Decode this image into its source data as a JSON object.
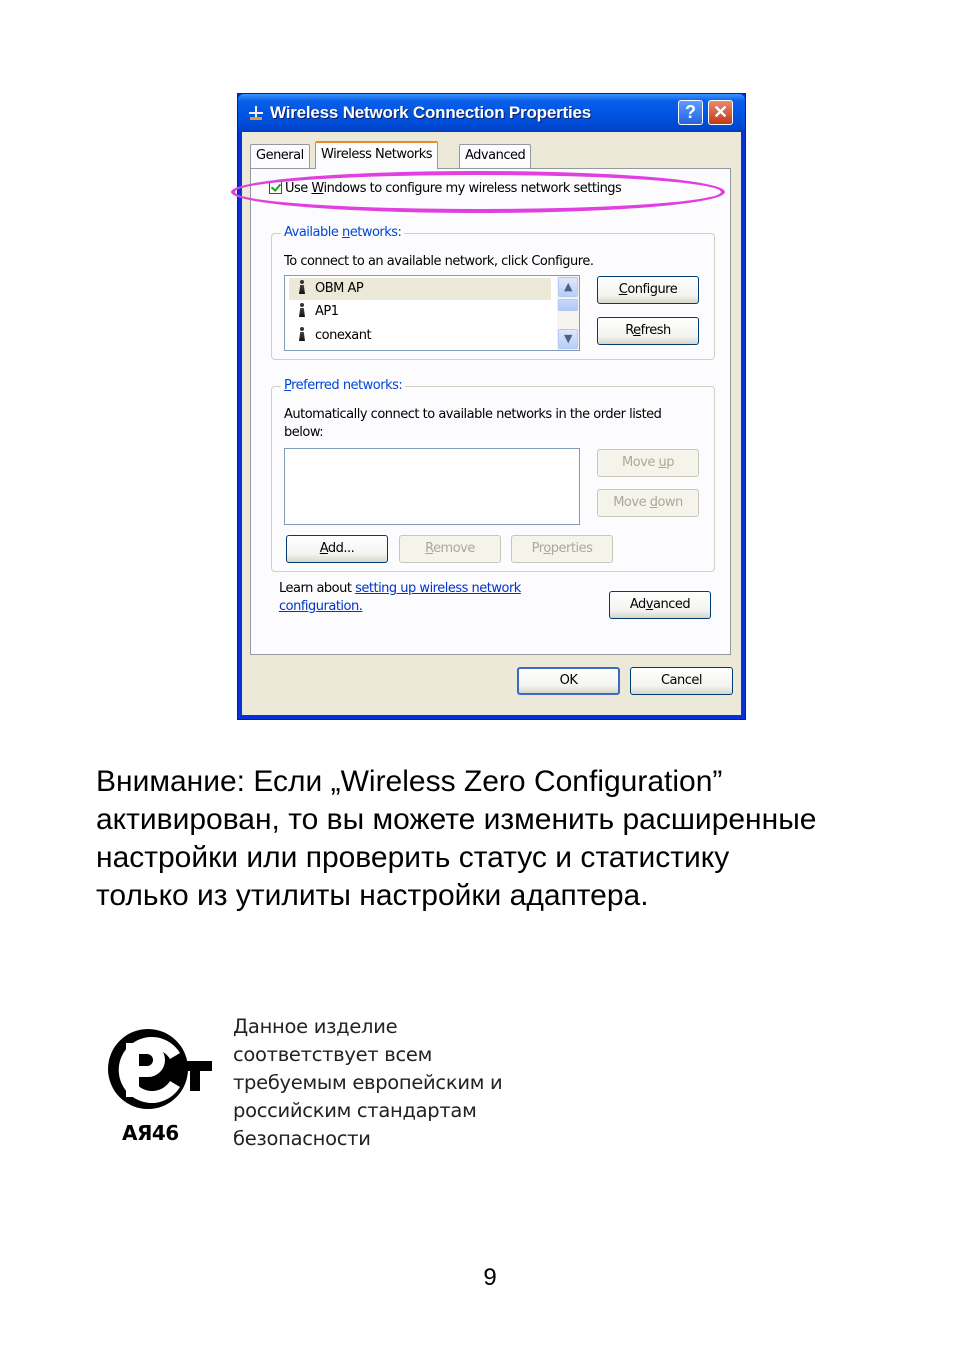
{
  "dialog": {
    "title": "Wireless Network Connection Properties",
    "help_btn": "?",
    "close_btn": "✕",
    "tabs": [
      {
        "label": "General"
      },
      {
        "label": "Wireless Networks"
      },
      {
        "label": "Advanced"
      }
    ],
    "use_windows_checkbox": {
      "pre": "Use ",
      "accel": "W",
      "post": "indows to configure my wireless network settings",
      "checked": true
    },
    "available": {
      "label_pre": "Available ",
      "label_accel": "n",
      "label_post": "etworks:",
      "description": "To connect to an available network, click Configure.",
      "networks": [
        "OBM AP",
        "AP1",
        "conexant"
      ],
      "configure_btn": {
        "accel": "C",
        "post": "onfigure"
      },
      "refresh_btn": {
        "pre": "R",
        "accel": "e",
        "post": "fresh"
      }
    },
    "preferred": {
      "label_accel": "P",
      "label_post": "referred networks:",
      "description_line1": "Automatically connect to available networks in the order listed",
      "description_line2": "below:",
      "move_up_btn": {
        "pre": "Move ",
        "accel": "u",
        "post": "p"
      },
      "move_down_btn": {
        "pre": "Move ",
        "accel": "d",
        "post": "own"
      },
      "add_btn": {
        "accel": "A",
        "post": "dd..."
      },
      "remove_btn": {
        "accel": "R",
        "post": "emove"
      },
      "properties_btn": {
        "pre": "Pr",
        "accel": "o",
        "post": "perties"
      }
    },
    "learn_about": {
      "prefix": "Learn about ",
      "link_line1": "setting up wireless network",
      "link_line2": "configuration."
    },
    "advanced_btn": {
      "pre": "Ad",
      "accel": "v",
      "post": "anced"
    },
    "ok_btn": "OK",
    "cancel_btn": "Cancel"
  },
  "note": {
    "line1": "Внимание: Если „Wireless Zero Configuration”",
    "line2": "активирован, то вы можете изменить расширенные",
    "line3": "настройки или проверить статус и статистику",
    "line4": "только из утилиты настройки адаптера."
  },
  "certification": {
    "code": "АЯ46",
    "lines": [
      "Данное изделие",
      "соответствует всем",
      "требуемым европейским и",
      "российским стандартам",
      "безопасности"
    ]
  },
  "page_number": "9"
}
